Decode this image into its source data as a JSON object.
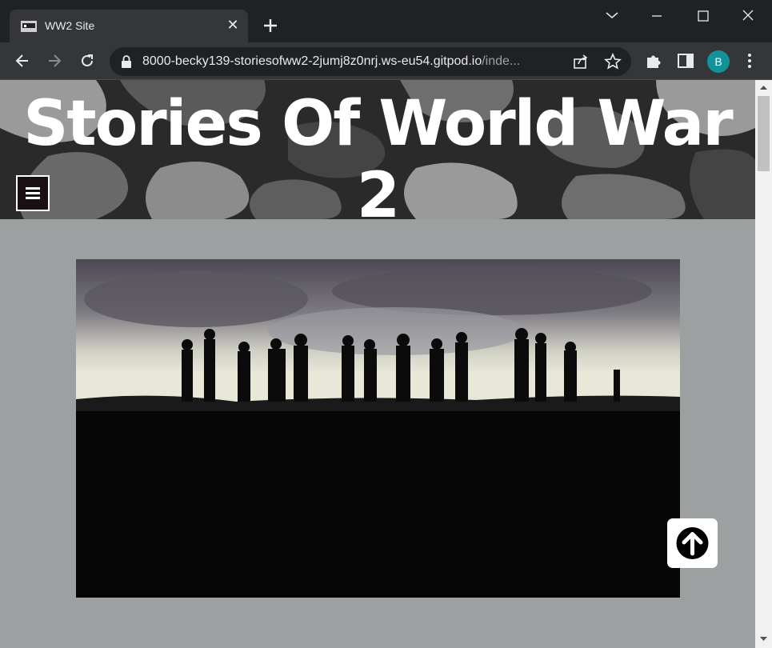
{
  "browser": {
    "tab": {
      "title": "WW2 Site",
      "close_glyph": "✕"
    },
    "url": {
      "main": "8000-becky139-storiesofww2-2jumj8z0nrj.ws-eu54.gitpod.io",
      "dim": "/inde..."
    },
    "profile_initial": "B",
    "icons": [
      "back-icon",
      "forward-icon",
      "reload-icon",
      "lock-icon",
      "share-icon",
      "star-icon",
      "extensions-icon",
      "side-panel-icon",
      "menu-dots-icon",
      "new-tab-icon",
      "tab-search-icon",
      "minimize-icon",
      "maximize-icon",
      "close-window-icon"
    ]
  },
  "page": {
    "site_title": "Stories Of World War 2",
    "menu_icon": "hamburger-icon",
    "hero_image": "soldiers-silhouette-image",
    "back_to_top_icon": "arrow-up-circle-icon"
  },
  "colors": {
    "page_background": "#9da0a0",
    "header_text": "#ffffff",
    "avatar": "#12939a"
  }
}
